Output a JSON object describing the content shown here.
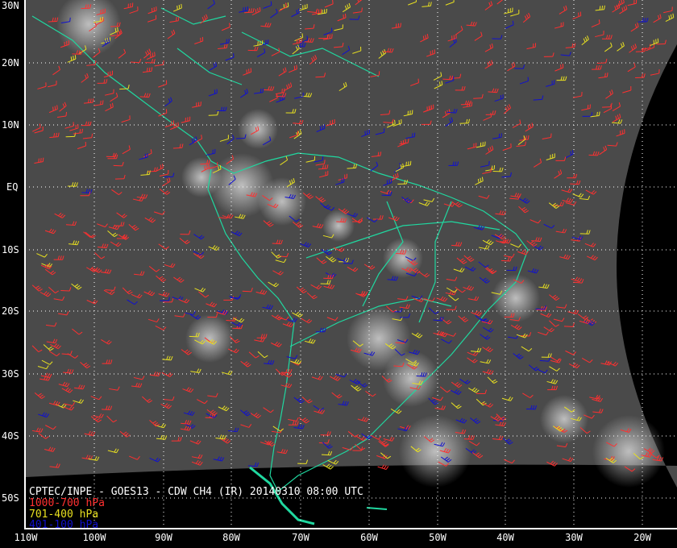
{
  "title": "CPTEC/INPE - GOES13 - CDW CH4 (IR) 20140310 08:00 UTC",
  "legend": [
    {
      "label": "1000-700 hPa",
      "color": "#ff3030"
    },
    {
      "label": "701-400 hPa",
      "color": "#e8e020"
    },
    {
      "label": "401-100 hPa",
      "color": "#1010d0"
    }
  ],
  "lat_labels": [
    "30N",
    "20N",
    "10N",
    "EQ",
    "10S",
    "20S",
    "30S",
    "40S",
    "50S"
  ],
  "lon_labels": [
    "110W",
    "100W",
    "90W",
    "80W",
    "70W",
    "60W",
    "50W",
    "40W",
    "30W",
    "20W"
  ],
  "colors": {
    "coast": "#20d8a0",
    "grid": "#ffffff",
    "background": "#000000"
  }
}
